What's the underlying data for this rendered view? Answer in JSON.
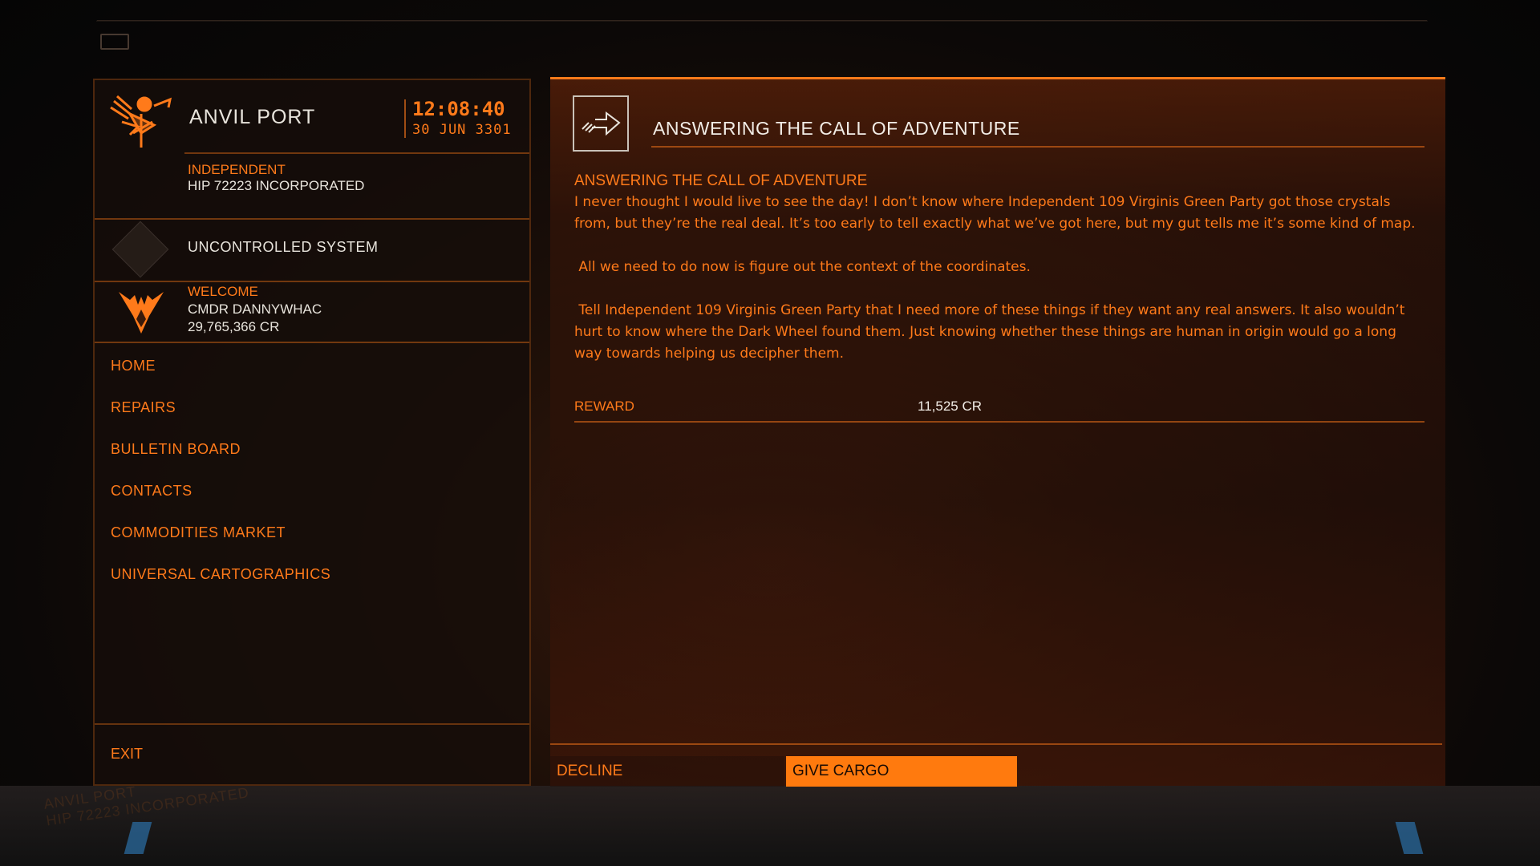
{
  "colors": {
    "accent": "#ff7a1a",
    "text_light": "#e8e4dc",
    "panel_dark": "#160e0a"
  },
  "station": {
    "name": "ANVIL PORT",
    "time": "12:08:40",
    "date": "30 JUN 3301",
    "allegiance": "INDEPENDENT",
    "faction": "HIP 72223 INCORPORATED",
    "icon": "station-icon"
  },
  "system": {
    "status": "UNCONTROLLED SYSTEM",
    "icon": "diamond-icon"
  },
  "cmdr": {
    "welcome": "WELCOME",
    "name": "CMDR DANNYWHAC",
    "credits": "29,765,366 CR",
    "icon": "empire-emblem-icon"
  },
  "nav": {
    "items": [
      {
        "label": "HOME"
      },
      {
        "label": "REPAIRS"
      },
      {
        "label": "BULLETIN BOARD"
      },
      {
        "label": "CONTACTS"
      },
      {
        "label": "COMMODITIES MARKET"
      },
      {
        "label": "UNIVERSAL CARTOGRAPHICS"
      }
    ],
    "exit": "EXIT"
  },
  "mission": {
    "header_title": "ANSWERING THE CALL OF ADVENTURE",
    "header_icon": "arrow-right-icon",
    "sub_title": "ANSWERING THE CALL OF ADVENTURE",
    "paragraphs": [
      "I never thought I would live to see the day! I don’t know where Independent 109 Virginis Green Party got those crystals from, but they’re the real deal. It’s too early to tell exactly what we’ve got here, but my gut tells me it’s some kind of map.",
      " All we need to do now is figure out the context of the coordinates.",
      " Tell Independent 109 Virginis Green Party that I need more of these things if they want any real answers. It also wouldn’t hurt to know where the Dark Wheel found them. Just knowing whether these things are human in origin would go a long way towards helping us decipher them."
    ],
    "reward_label": "REWARD",
    "reward_value": "11,525 CR"
  },
  "actions": {
    "decline": "DECLINE",
    "give_cargo": "GIVE CARGO"
  }
}
